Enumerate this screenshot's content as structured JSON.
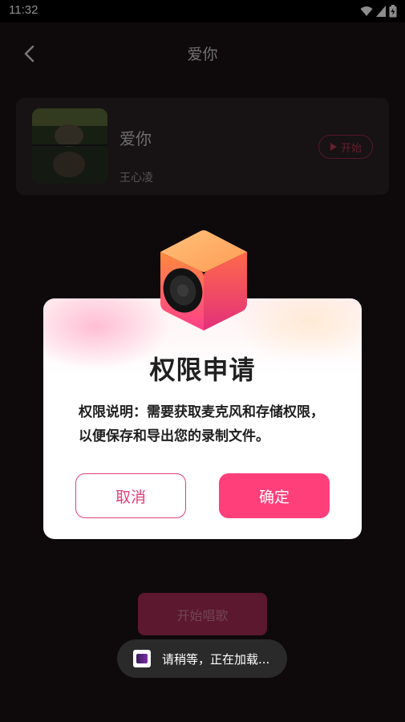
{
  "status_bar": {
    "time": "11:32"
  },
  "header": {
    "title": "爱你"
  },
  "song": {
    "title": "爱你",
    "artist": "王心凌",
    "start_label": "开始"
  },
  "bottom": {
    "sing_label": "开始唱歌"
  },
  "dialog": {
    "title": "权限申请",
    "body": "权限说明：需要获取麦克风和存储权限，以便保存和导出您的录制文件。",
    "cancel_label": "取消",
    "confirm_label": "确定"
  },
  "toast": {
    "text": "请稍等，正在加载..."
  },
  "colors": {
    "accent": "#ff3f7a",
    "accent_dim": "#a62c57",
    "background": "#1a1214"
  }
}
